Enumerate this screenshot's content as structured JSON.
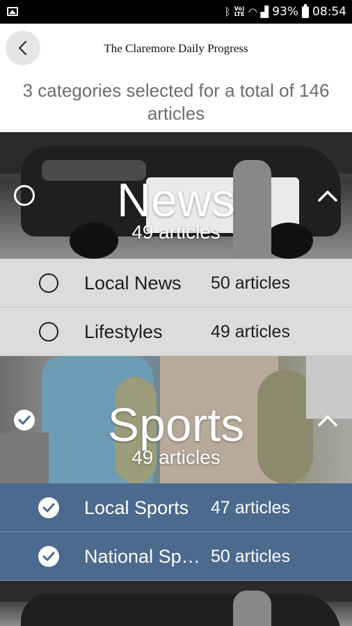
{
  "status_bar": {
    "icons": [
      "gallery-icon",
      "bluetooth-icon",
      "volte-icon",
      "wifi-icon",
      "signal-icon",
      "battery-icon"
    ],
    "volte_line1": "Vo)",
    "volte_line2": "LTE",
    "battery": "93%",
    "time": "08:54"
  },
  "header": {
    "back_icon": "chevron-left-icon",
    "paper_title": "The Claremore Daily Progress",
    "summary": "3 categories selected for a total of 146 articles"
  },
  "categories": [
    {
      "name": "News",
      "count": "49 articles",
      "selected": false,
      "expanded": true,
      "subcategories": [
        {
          "name": "Local News",
          "count": "50 articles",
          "selected": false
        },
        {
          "name": "Lifestyles",
          "count": "49 articles",
          "selected": false
        }
      ]
    },
    {
      "name": "Sports",
      "count": "49 articles",
      "selected": true,
      "expanded": true,
      "subcategories": [
        {
          "name": "Local Sports",
          "count": "47 articles",
          "selected": true
        },
        {
          "name": "National Sports",
          "count": "50 articles",
          "selected": true
        }
      ]
    }
  ],
  "colors": {
    "selected_row": "#4b6a8e",
    "unselected_row": "#dcdcdc",
    "summary_text": "#6d6d6d"
  }
}
